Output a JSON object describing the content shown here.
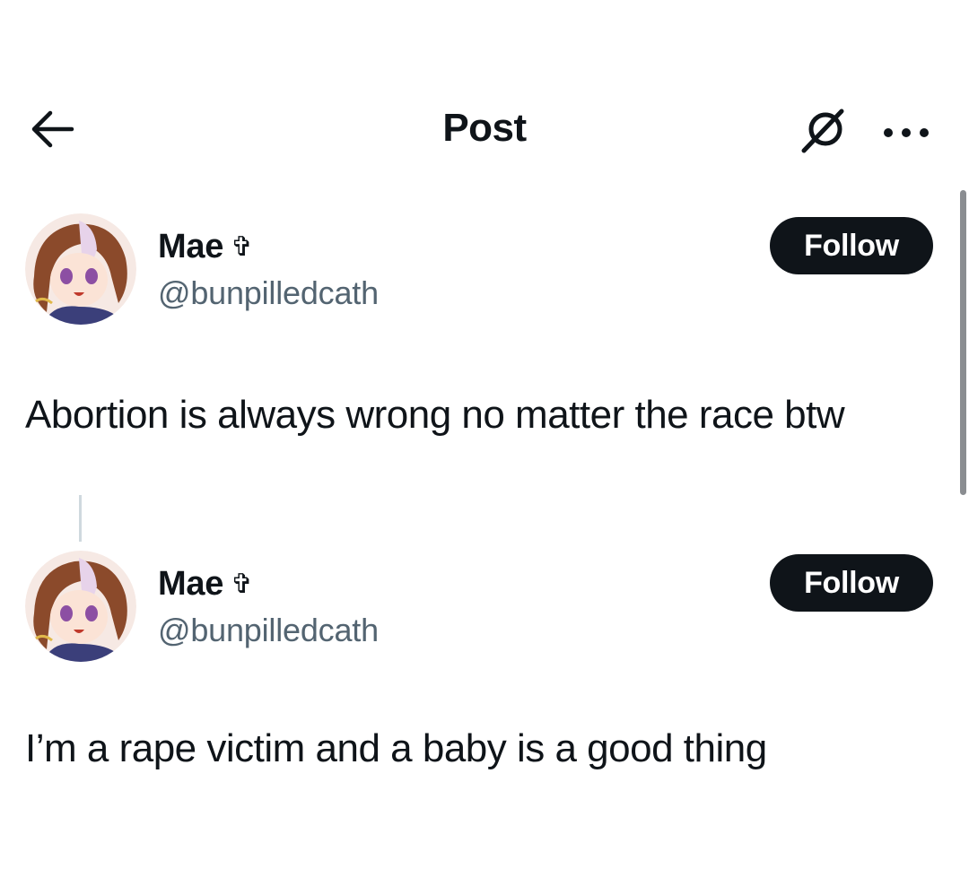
{
  "header": {
    "title": "Post",
    "back_icon": "arrow-left-icon",
    "grok_icon": "grok-icon",
    "more_icon": "more-horizontal-icon"
  },
  "posts": [
    {
      "display_name": "Mae",
      "badge": "✞",
      "handle": "@bunpilledcath",
      "follow_label": "Follow",
      "text": "Abortion is always wrong no matter the race btw"
    },
    {
      "display_name": "Mae",
      "badge": "✞",
      "handle": "@bunpilledcath",
      "follow_label": "Follow",
      "text": "I’m a rape victim and a baby is a good thing"
    }
  ],
  "colors": {
    "text_primary": "#0f1419",
    "text_secondary": "#536471",
    "button_bg": "#0f1419",
    "button_text": "#ffffff",
    "thread_line": "#cfd9de"
  }
}
